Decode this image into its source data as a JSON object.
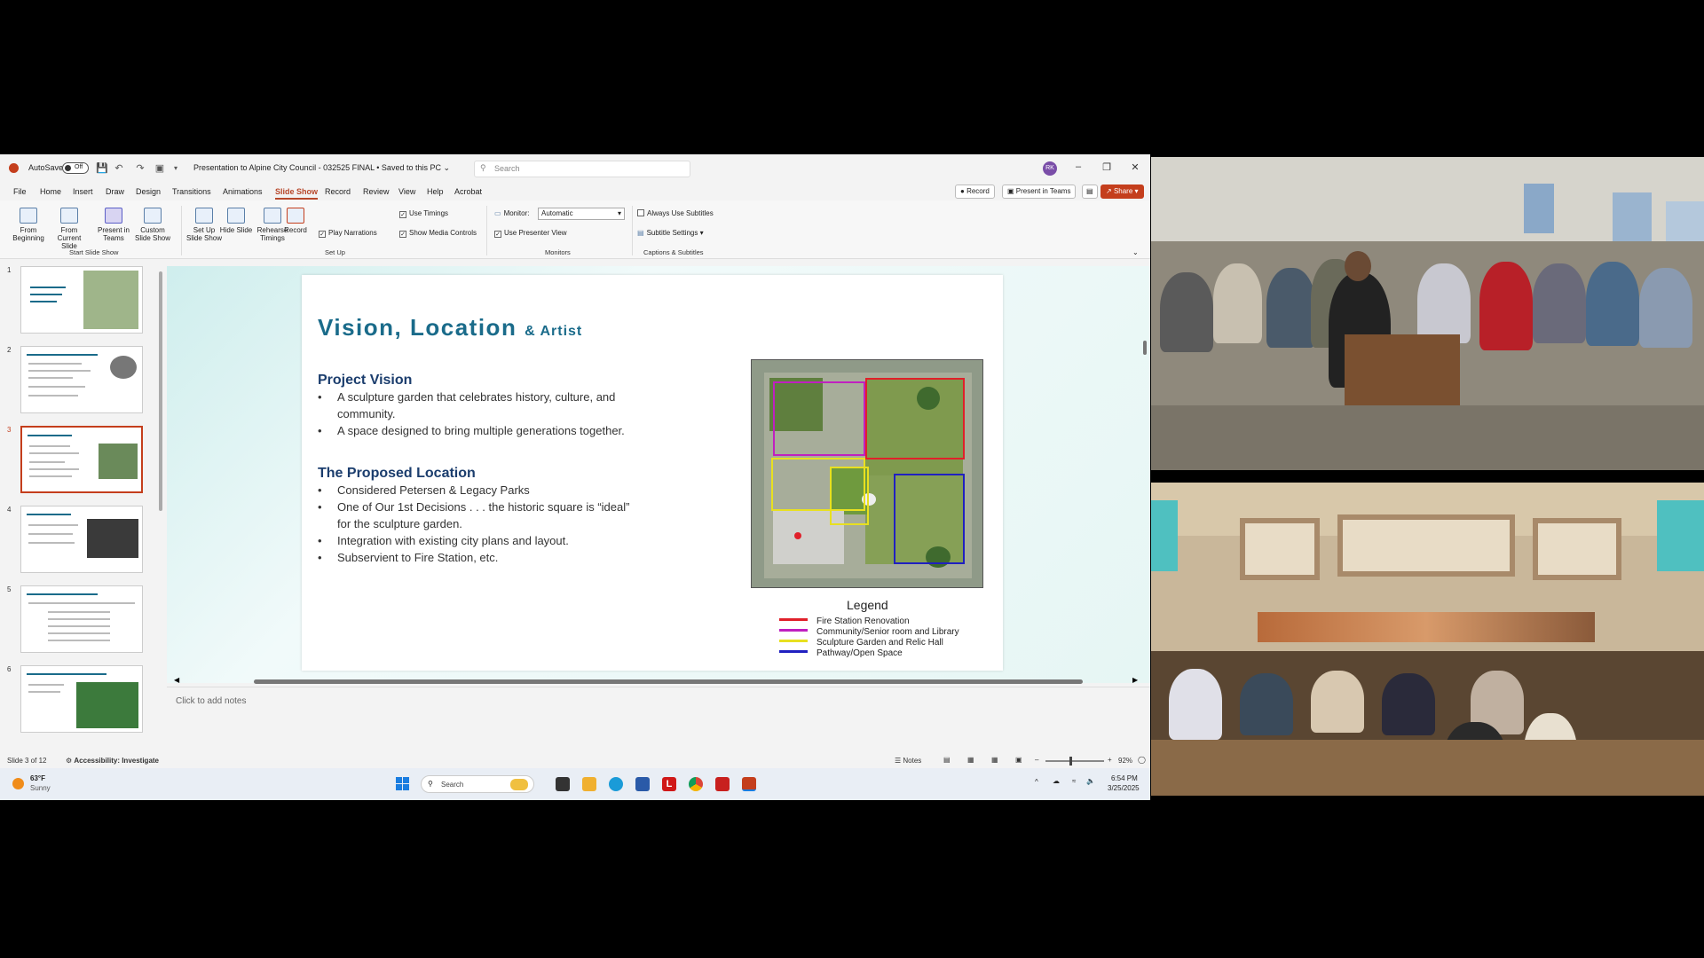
{
  "window": {
    "autosave_label": "AutoSave",
    "autosave_state": "Off",
    "doc_title": "Presentation to Alpine City Council - 032525 FINAL • Saved to this PC ⌄",
    "search_placeholder": "Search",
    "avatar_initials": "RK"
  },
  "menu": {
    "tabs": [
      "File",
      "Home",
      "Insert",
      "Draw",
      "Design",
      "Transitions",
      "Animations",
      "Slide Show",
      "Record",
      "Review",
      "View",
      "Help",
      "Acrobat"
    ],
    "active_tab": "Slide Show",
    "record_btn": "Record",
    "present_teams_btn": "Present in Teams",
    "share_btn": "Share"
  },
  "ribbon": {
    "from_beginning": "From Beginning",
    "from_current": "From Current Slide",
    "present_teams": "Present in Teams",
    "custom_show": "Custom Slide Show",
    "setup_show": "Set Up Slide Show",
    "hide_slide": "Hide Slide",
    "rehearse": "Rehearse Timings",
    "record": "Record",
    "play_narrations": "Play Narrations",
    "use_timings": "Use Timings",
    "show_media_controls": "Show Media Controls",
    "monitor_label": "Monitor:",
    "monitor_value": "Automatic",
    "use_presenter_view": "Use Presenter View",
    "always_subtitles": "Always Use Subtitles",
    "subtitle_settings": "Subtitle Settings",
    "group_start": "Start Slide Show",
    "group_setup": "Set Up",
    "group_monitors": "Monitors",
    "group_captions": "Captions & Subtitles"
  },
  "thumbnails": {
    "numbers": [
      "1",
      "2",
      "3",
      "4",
      "5",
      "6"
    ],
    "selected_index": 3
  },
  "slide": {
    "title": "Vision, Location",
    "title_suffix": "& Artist",
    "section1_heading": "Project Vision",
    "section1_bullets": [
      "A sculpture garden that celebrates history, culture, and",
      "community.",
      "A space designed to bring multiple generations together."
    ],
    "section2_heading": "The Proposed Location",
    "section2_bullets": [
      "Considered Petersen & Legacy Parks",
      "One of Our 1st Decisions . . . the historic square is “ideal”",
      "for the sculpture garden.",
      "Integration with existing city plans and layout.",
      "Subservient to Fire Station, etc."
    ],
    "legend_title": "Legend",
    "legend": [
      {
        "label": "Fire Station Renovation",
        "color": "#e0202a"
      },
      {
        "label": "Community/Senior room and Library",
        "color": "#c020c0"
      },
      {
        "label": "Sculpture Garden and Relic Hall",
        "color": "#e8e020"
      },
      {
        "label": "Pathway/Open Space",
        "color": "#2020c0"
      }
    ]
  },
  "notes_placeholder": "Click to add notes",
  "status": {
    "slide_count": "Slide 3 of 12",
    "accessibility": "Accessibility: Investigate",
    "notes": "Notes",
    "zoom": "92%"
  },
  "taskbar": {
    "weather_temp": "63°F",
    "weather_desc": "Sunny",
    "search": "Search",
    "time": "6:54 PM",
    "date": "3/25/2025"
  }
}
